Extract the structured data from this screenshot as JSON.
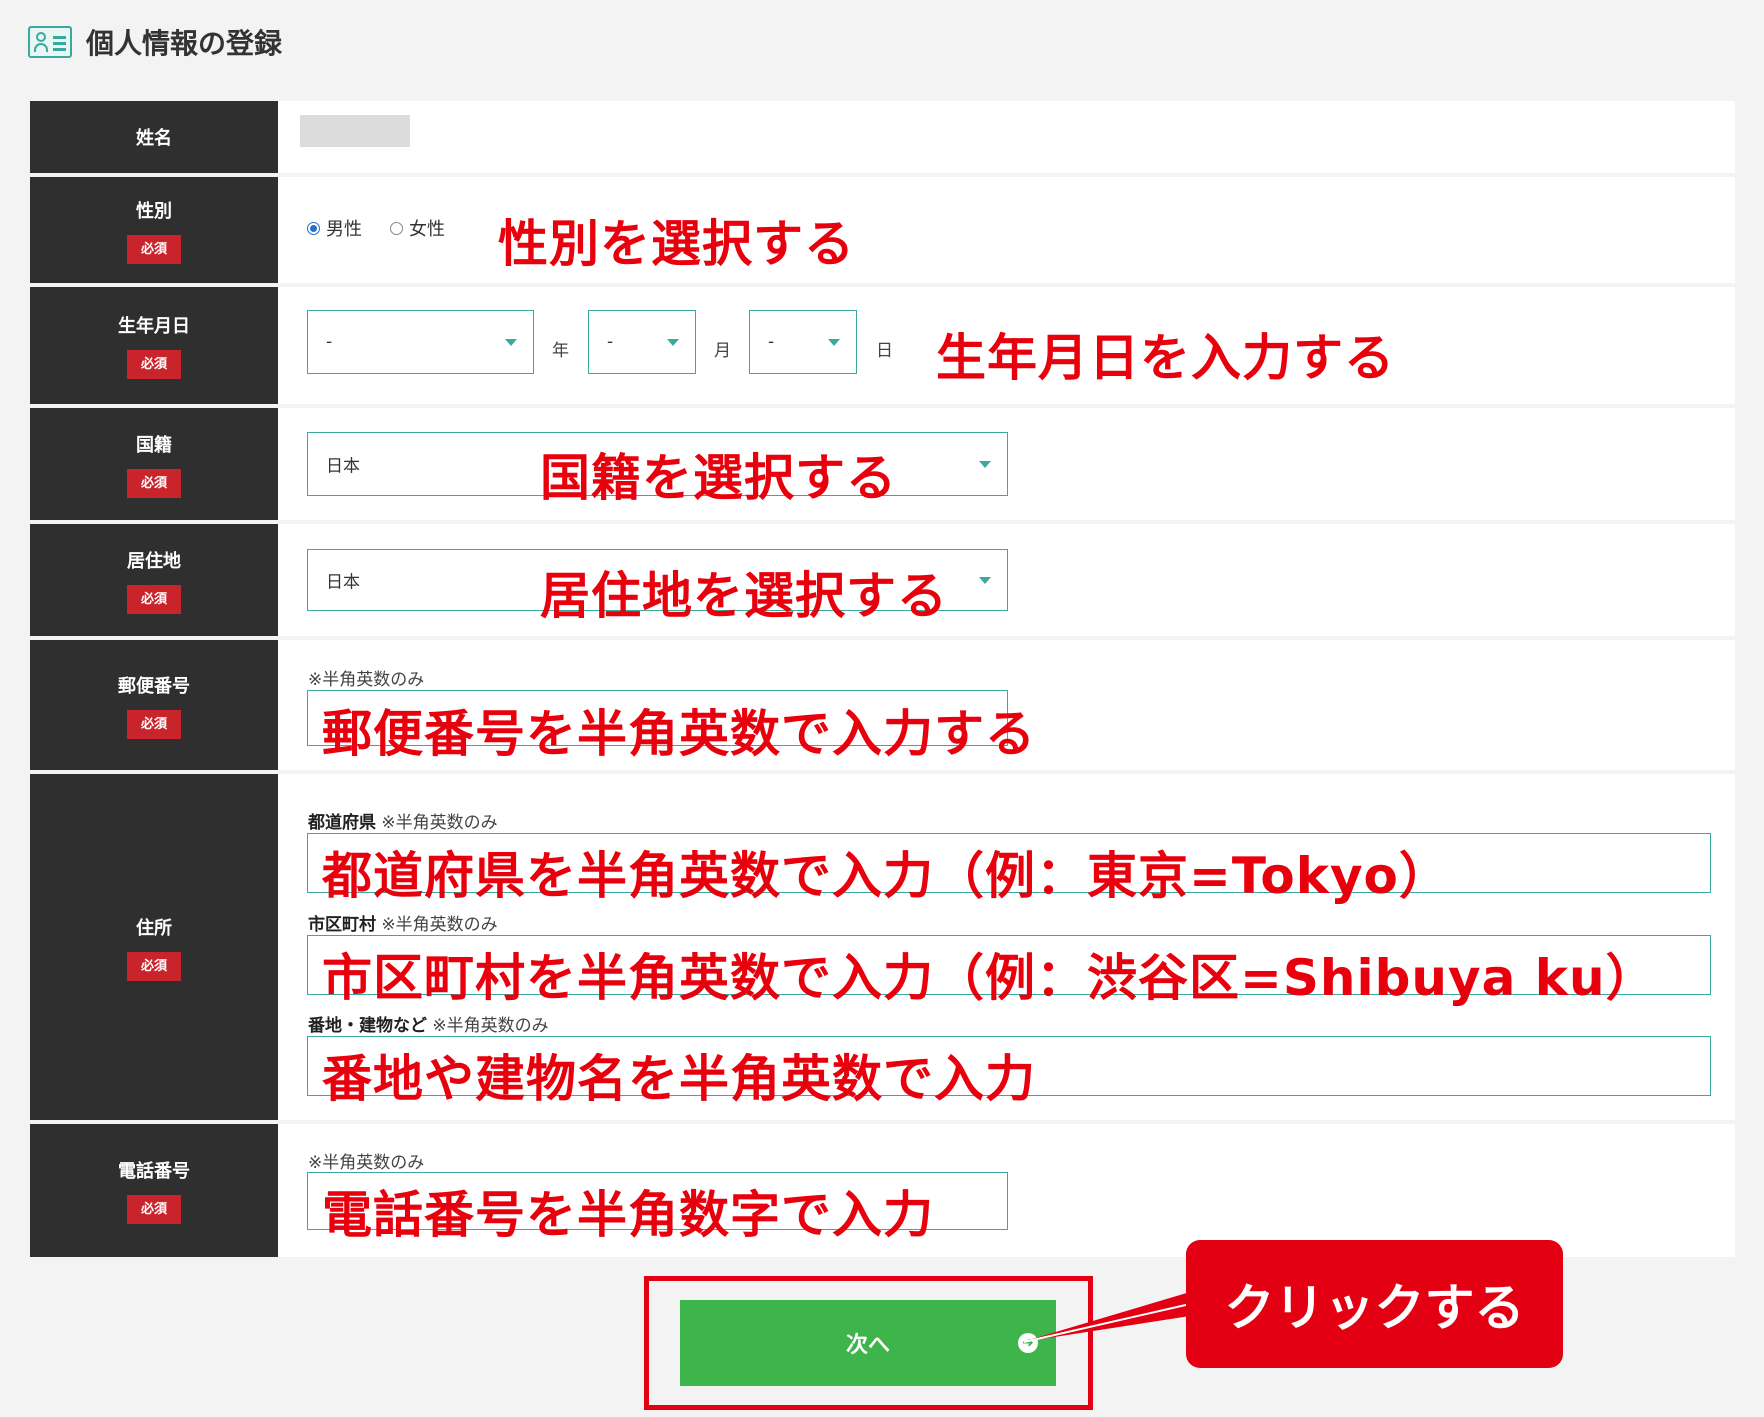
{
  "header": {
    "title": "個人情報の登録",
    "icon": "profile-card-icon"
  },
  "fields": {
    "name": {
      "label": "姓名"
    },
    "gender": {
      "label": "性別",
      "required": "必須",
      "options": [
        "男性",
        "女性"
      ],
      "selected": "男性",
      "annotation": "性別を選択する"
    },
    "birthdate": {
      "label": "生年月日",
      "required": "必須",
      "year_value": "-",
      "month_value": "-",
      "day_value": "-",
      "year_unit": "年",
      "month_unit": "月",
      "day_unit": "日",
      "annotation": "生年月日を入力する"
    },
    "nationality": {
      "label": "国籍",
      "required": "必須",
      "value": "日本",
      "annotation": "国籍を選択する"
    },
    "residence": {
      "label": "居住地",
      "required": "必須",
      "value": "日本",
      "annotation": "居住地を選択する"
    },
    "postal": {
      "label": "郵便番号",
      "required": "必須",
      "note": "※半角英数のみ",
      "annotation": "郵便番号を半角英数で入力する"
    },
    "address": {
      "label": "住所",
      "required": "必須",
      "prefecture_label": "都道府県",
      "prefecture_note": "※半角英数のみ",
      "prefecture_annotation": "都道府県を半角英数で入力（例：東京=Tokyo）",
      "city_label": "市区町村",
      "city_note": "※半角英数のみ",
      "city_annotation": "市区町村を半角英数で入力（例：渋谷区=Shibuya ku）",
      "street_label": "番地・建物など",
      "street_note": "※半角英数のみ",
      "street_annotation": "番地や建物名を半角英数で入力"
    },
    "phone": {
      "label": "電話番号",
      "required": "必須",
      "note": "※半角英数のみ",
      "annotation": "電話番号を半角数字で入力"
    }
  },
  "next_button": {
    "label": "次へ",
    "icon": "arrow-right-circle-icon"
  },
  "callout": {
    "text": "クリックする"
  },
  "colors": {
    "accent": "#3aa99f",
    "annotation": "#e8000d",
    "button": "#3db54a",
    "label_bg": "#2f2f2f",
    "required_badge": "#c9242b"
  }
}
